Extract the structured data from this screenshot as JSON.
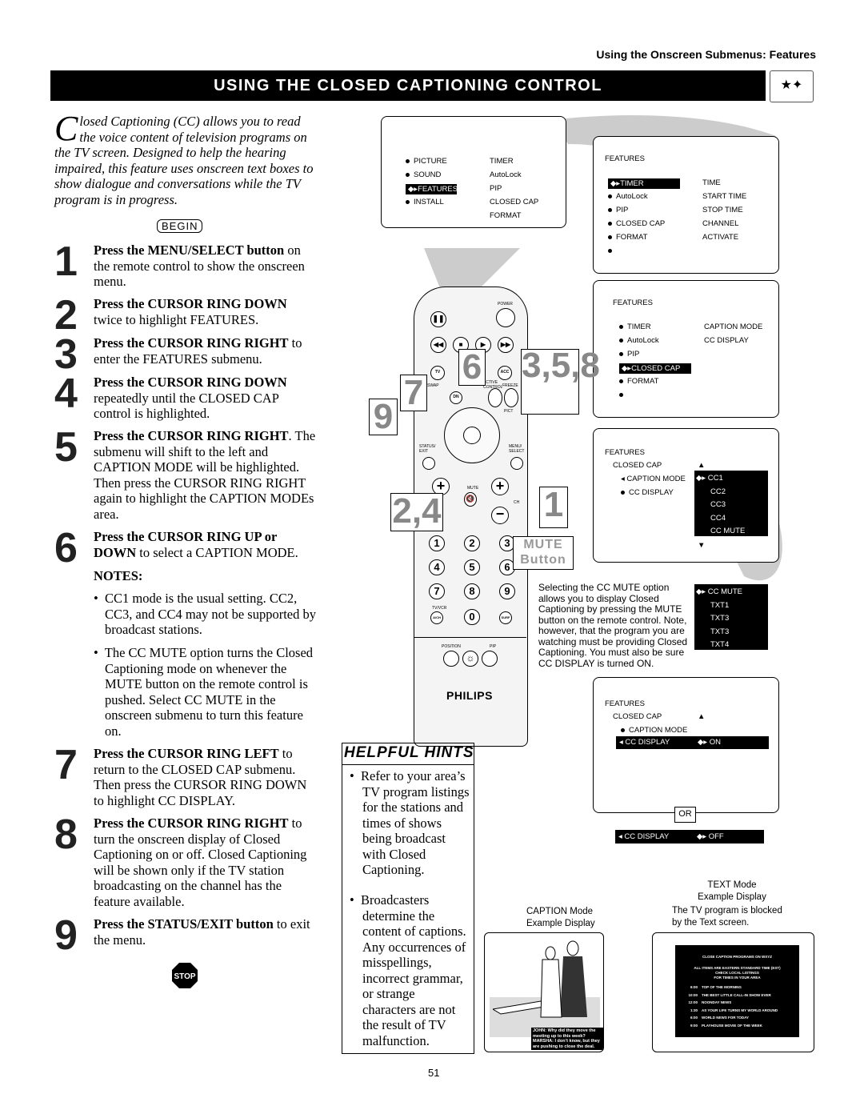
{
  "header": {
    "section": "Using the Onscreen Submenus: Features",
    "title": "USING THE CLOSED CAPTIONING CONTROL",
    "icon": "stars-icon"
  },
  "intro": {
    "dropcap": "C",
    "text": "losed Captioning (CC) allows you to read the voice content of television programs on the TV screen. Designed to help the hearing impaired, this feature uses onscreen text boxes to show dialogue and conversations while the TV program is in progress."
  },
  "begin": "BEGIN",
  "steps": [
    {
      "num": "1",
      "bold": "Press the MENU/SELECT button",
      "text": " on the remote control to show the onscreen menu."
    },
    {
      "num": "2",
      "bold": "Press the CURSOR RING DOWN",
      "text": " twice to highlight FEATURES."
    },
    {
      "num": "3",
      "bold": "Press the CURSOR RING RIGHT",
      "text": " to enter the FEATURES submenu."
    },
    {
      "num": "4",
      "bold": "Press the CURSOR RING DOWN",
      "text": " repeatedly until the CLOSED CAP control is highlighted."
    },
    {
      "num": "5",
      "bold": "Press the CURSOR RING RIGHT",
      "text": ". The submenu will shift to the left and CAPTION MODE will be highlighted. Then press the CURSOR RING RIGHT again to highlight the CAPTION MODEs area."
    },
    {
      "num": "6",
      "bold": "Press the CURSOR RING UP or DOWN",
      "text": " to select a CAPTION MODE."
    },
    {
      "num": "7",
      "bold": "Press the CURSOR RING LEFT",
      "text": " to return to the CLOSED CAP submenu. Then press the CURSOR RING DOWN to highlight CC DISPLAY."
    },
    {
      "num": "8",
      "bold": "Press the CURSOR RING RIGHT",
      "text": " to turn the onscreen display of Closed Captioning on or off. Closed Captioning will be shown only if the TV station broadcasting on the channel has the feature available."
    },
    {
      "num": "9",
      "bold": "Press the STATUS/EXIT button",
      "text": " to exit the menu."
    }
  ],
  "notes": {
    "title": "NOTES:",
    "items": [
      "CC1 mode is the usual setting. CC2, CC3, and CC4 may not be supported by broadcast stations.",
      "The CC MUTE option turns the Closed Captioning mode on whenever the MUTE button on the remote control is pushed. Select CC MUTE in the onscreen submenu to turn this feature on."
    ]
  },
  "stop_icon": "STOP",
  "main_menu": {
    "left": [
      "PICTURE",
      "SOUND",
      "FEATURES",
      "INSTALL"
    ],
    "right": [
      "TIMER",
      "AutoLock",
      "PIP",
      "CLOSED CAP",
      "FORMAT"
    ],
    "selected": "FEATURES"
  },
  "menu_a": {
    "title": "FEATURES",
    "left": [
      "TIMER",
      "AutoLock",
      "PIP",
      "CLOSED CAP",
      "FORMAT",
      ""
    ],
    "right": [
      "TIME",
      "START TIME",
      "STOP TIME",
      "CHANNEL",
      "ACTIVATE"
    ]
  },
  "menu_b": {
    "title": "FEATURES",
    "left": [
      "TIMER",
      "AutoLock",
      "PIP",
      "CLOSED CAP",
      "FORMAT",
      ""
    ],
    "right": [
      "CAPTION MODE",
      "CC DISPLAY"
    ]
  },
  "menu_c": {
    "title": "FEATURES",
    "sub": "CLOSED CAP",
    "left": [
      "CAPTION MODE",
      "CC DISPLAY"
    ],
    "modes": [
      "CC1",
      "CC2",
      "CC3",
      "CC4",
      "CC MUTE"
    ]
  },
  "mute_modes": [
    "CC MUTE",
    "TXT1",
    "TXT3",
    "TXT3",
    "TXT4"
  ],
  "menu_d": {
    "title": "FEATURES",
    "sub": "CLOSED CAP",
    "item1": "CAPTION MODE",
    "item2": "CC DISPLAY",
    "value": "ON"
  },
  "or_label": "OR",
  "off_strip": {
    "item": "CC DISPLAY",
    "value": "OFF"
  },
  "remote": {
    "brand": "PHILIPS",
    "power": "POWER",
    "tv": "TV",
    "acc": "ACC",
    "swap": "SWAP",
    "active": "ACTIVE CONTROL",
    "freeze": "FREEZE",
    "dn": "DN",
    "pict": "PICT",
    "status": "STATUS/ EXIT",
    "menu": "MENU/ SELECT",
    "mute": "MUTE",
    "ch": "CH",
    "tvvcr": "TV/VCR",
    "ach": "A/CH",
    "surf": "SURF",
    "position": "POSITION",
    "pip": "PIP",
    "digits": [
      "1",
      "2",
      "3",
      "4",
      "5",
      "6",
      "7",
      "8",
      "9",
      "0"
    ]
  },
  "callouts": {
    "c6": "6",
    "c358": "3,5,8",
    "c7": "7",
    "c9": "9",
    "c24": "2,4",
    "c1": "1",
    "mute_line1": "MUTE",
    "mute_line2": "Button"
  },
  "mute_text": "Selecting the CC MUTE option allows you to display Closed Captioning by pressing the MUTE button on the remote control. Note, however, that the program you are watching must be providing Closed Captioning. You must also be sure CC DISPLAY is turned ON.",
  "hints": {
    "title": "HELPFUL HINTS",
    "items": [
      "Refer to your area’s TV program listings for the stations and times of shows being broadcast with Closed Captioning.",
      "Broadcasters determine the content of captions. Any occurrences of misspellings, incorrect grammar, or strange characters are not the result of TV malfunction."
    ]
  },
  "caption_mode": {
    "label1": "CAPTION Mode",
    "label2": "Example Display",
    "caption": "JOHN: Why did they move the meeting up to this week? MARSHA: I don’t know, but they are pushing to close the deal."
  },
  "text_mode": {
    "label1": "TEXT Mode",
    "label2": "Example Display",
    "desc1": "The TV program is blocked",
    "desc2": "by the Text screen.",
    "title": "CLOSE CAPTION PROGRAMS ON WXYZ",
    "note": [
      "ALL ITEMS ARE EASTERN STANDARD TIME (EST)",
      "CHECK LOCAL LISTINGS",
      "FOR TIMES IN YOUR AREA"
    ],
    "listings": [
      {
        "time": "6:00",
        "show": "TOP OF THE MORNING"
      },
      {
        "time": "10:00",
        "show": "THE BEST LITTLE CALL-IN SHOW EVER"
      },
      {
        "time": "12:00",
        "show": "NOONDAY NEWS"
      },
      {
        "time": "1:30",
        "show": "AS YOUR LIFE TURNS MY WORLD AROUND"
      },
      {
        "time": "6:00",
        "show": "WORLD NEWS FOR TODAY"
      },
      {
        "time": "9:00",
        "show": "PLAYHOUSE MOVIE OF THE WEEK"
      }
    ]
  },
  "page_number": "51"
}
